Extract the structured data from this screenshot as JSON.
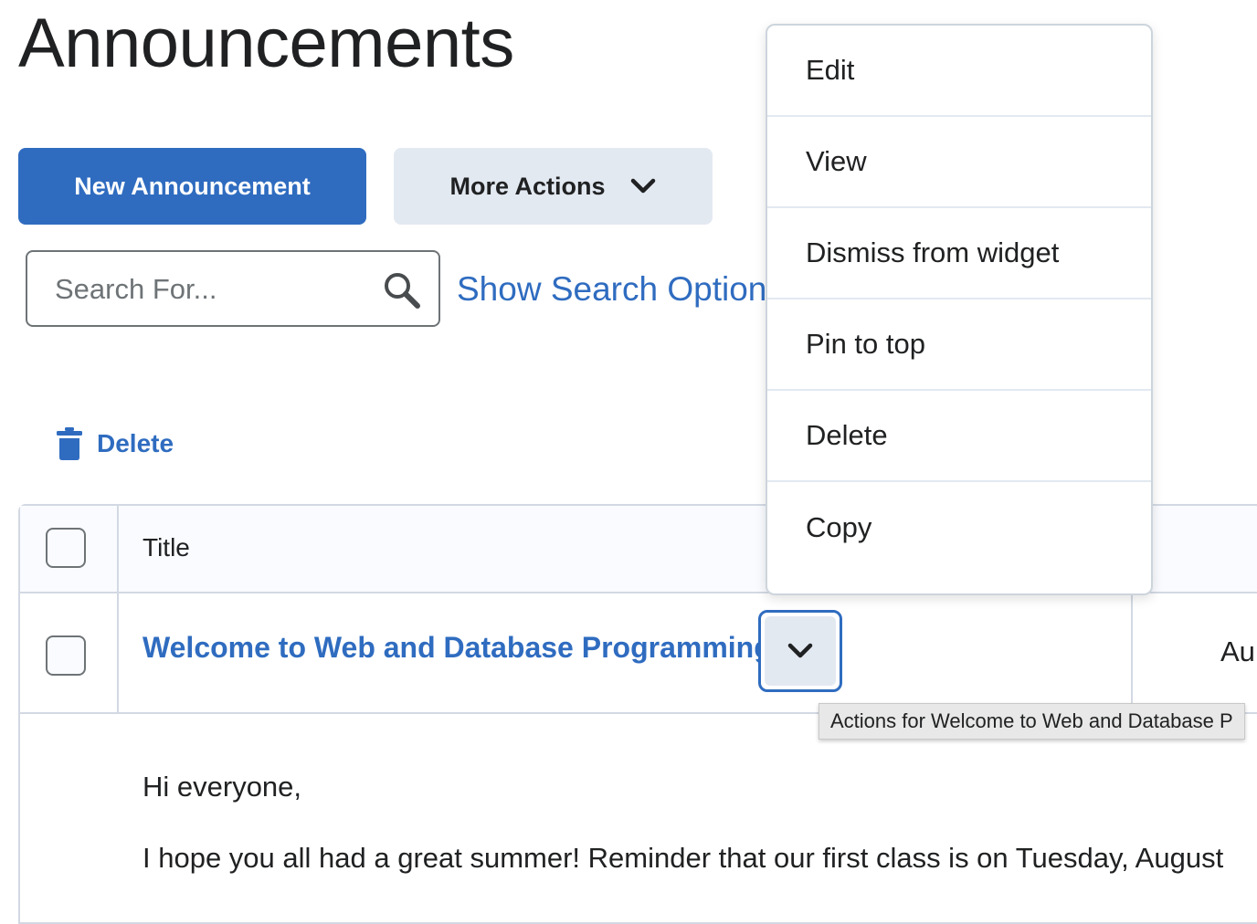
{
  "page": {
    "title": "Announcements"
  },
  "toolbar": {
    "new_label": "New Announcement",
    "more_label": "More Actions"
  },
  "search": {
    "placeholder": "Search For...",
    "options_link": "Show Search Options"
  },
  "bulk": {
    "delete_label": "Delete"
  },
  "table": {
    "header_title": "Title",
    "rows": [
      {
        "title": "Welcome to Web and Database Programming!",
        "date": "Au"
      }
    ]
  },
  "tooltip": {
    "text": "Actions for Welcome to Web and Database P"
  },
  "content": {
    "greeting": "Hi everyone,",
    "line1": "I hope you all had a great summer! Reminder that our first class is on Tuesday, August"
  },
  "menu": {
    "items": [
      "Edit",
      "View",
      "Dismiss from widget",
      "Pin to top",
      "Delete",
      "Copy"
    ]
  },
  "colors": {
    "primary": "#2f6cc0",
    "secondary_bg": "#e3e9f1",
    "text": "#202122",
    "border": "#d3d9e3"
  }
}
